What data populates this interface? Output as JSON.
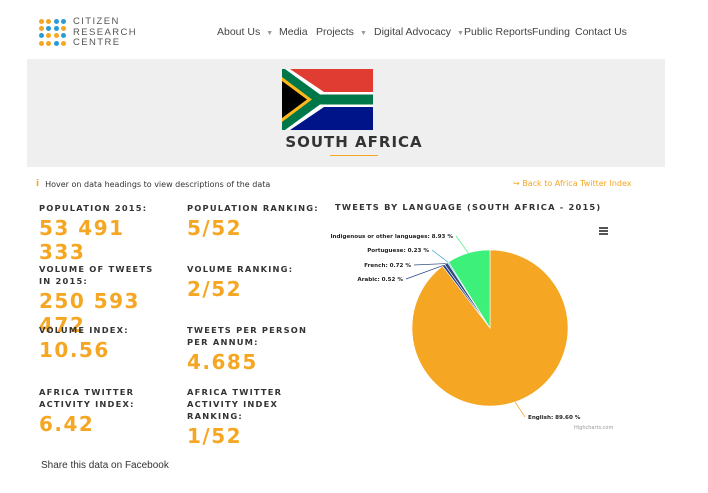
{
  "brand": {
    "line1": "CITIZEN",
    "line2": "RESEARCH",
    "line3": "CENTRE"
  },
  "nav": [
    {
      "label": "About Us",
      "dropdown": true
    },
    {
      "label": "Media",
      "dropdown": false
    },
    {
      "label": "Projects",
      "dropdown": true
    },
    {
      "label": "Digital Advocacy",
      "dropdown": true
    },
    {
      "label": "Public Reports",
      "dropdown": false
    },
    {
      "label": "Funding",
      "dropdown": false
    },
    {
      "label": "Contact Us",
      "dropdown": false
    }
  ],
  "country": {
    "name": "SOUTH AFRICA"
  },
  "hint": {
    "icon": "info-icon",
    "text": "Hover on data headings to view descriptions of the data"
  },
  "back_link": {
    "icon": "back-arrow-icon",
    "text": "Back to Africa Twitter Index"
  },
  "stats": {
    "population_label": "POPULATION 2015:",
    "population_value": "53 491 333",
    "population_ranking_label": "POPULATION RANKING:",
    "population_ranking_value": "5/52",
    "volume_label": "VOLUME OF TWEETS IN 2015:",
    "volume_value": "250 593 472",
    "volume_ranking_label": "VOLUME RANKING:",
    "volume_ranking_value": "2/52",
    "volume_index_label": "VOLUME INDEX:",
    "volume_index_value": "10.56",
    "tweets_per_person_label": "TWEETS PER PERSON PER ANNUM:",
    "tweets_per_person_value": "4.685",
    "activity_index_label": "AFRICA TWITTER ACTIVITY INDEX:",
    "activity_index_value": "6.42",
    "activity_ranking_label": "AFRICA TWITTER ACTIVITY INDEX RANKING:",
    "activity_ranking_value": "1/52"
  },
  "chart_data": {
    "type": "pie",
    "title": "TWEETS BY LANGUAGE (SOUTH AFRICA - 2015)",
    "slices": [
      {
        "label": "English",
        "value": 89.6,
        "display": "English: 89.60 %",
        "color": "#f5a623"
      },
      {
        "label": "Arabic",
        "value": 0.52,
        "display": "Arabic: 0.52 %",
        "color": "#1f3f87"
      },
      {
        "label": "French",
        "value": 0.72,
        "display": "French: 0.72 %",
        "color": "#2c4a7a"
      },
      {
        "label": "Portuguese",
        "value": 0.23,
        "display": "Portuguese: 0.23 %",
        "color": "#3aa3d9"
      },
      {
        "label": "Indigenous or other languages",
        "value": 8.93,
        "display": "Indigenous or other languages: 8.93 %",
        "color": "#3cf07a"
      }
    ],
    "credit": "Highcharts.com"
  },
  "share": {
    "text": "Share this data on Facebook"
  },
  "colors": {
    "accent": "#f5a623",
    "hero_bg": "#efefef",
    "logo_blue": "#2b9bd8"
  }
}
